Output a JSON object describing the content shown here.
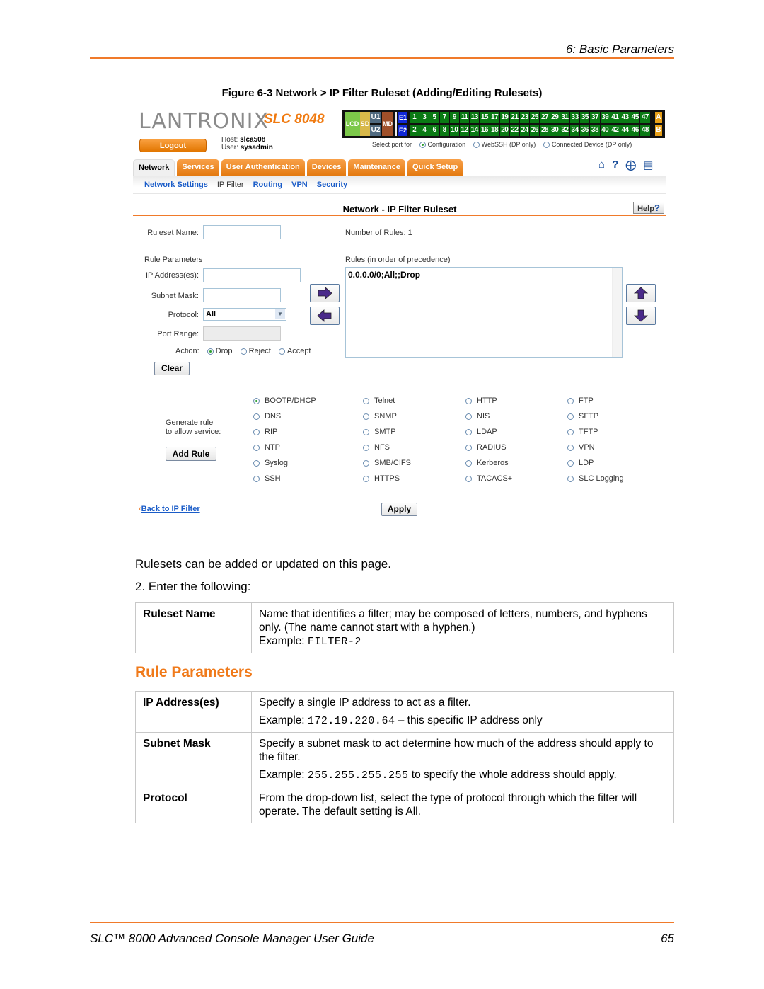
{
  "page": {
    "chapter": "6: Basic Parameters",
    "figure_caption": "Figure 6-3  Network > IP Filter Ruleset (Adding/Editing Rulesets)",
    "footer_title": "SLC™ 8000 Advanced Console Manager User Guide",
    "page_number": "65"
  },
  "colors": {
    "accent": "#f07a2a",
    "link": "#1a5cc8",
    "port_green": "#0a7a14"
  },
  "app": {
    "logo": "LANTRONIX",
    "model": "SLC 8048",
    "logout_label": "Logout",
    "host_label": "Host:",
    "host_value": "slca508",
    "user_label": "User:",
    "user_value": "sysadmin",
    "status_blocks": {
      "lcd": "LCD",
      "sd": "SD",
      "u1": "U1",
      "u2": "U2",
      "md": "MD",
      "e1": "E1",
      "e2": "E2",
      "a": "A",
      "b": "B"
    },
    "ports_odd": [
      "1",
      "3",
      "5",
      "7",
      "9",
      "11",
      "13",
      "15",
      "17",
      "19",
      "21",
      "23",
      "25",
      "27",
      "29",
      "31",
      "33",
      "35",
      "37",
      "39",
      "41",
      "43",
      "45",
      "47"
    ],
    "ports_even": [
      "2",
      "4",
      "6",
      "8",
      "10",
      "12",
      "14",
      "16",
      "18",
      "20",
      "22",
      "24",
      "26",
      "28",
      "30",
      "32",
      "34",
      "36",
      "38",
      "40",
      "42",
      "44",
      "46",
      "48"
    ],
    "select_port": {
      "label": "Select port for",
      "options": [
        {
          "label": "Configuration",
          "selected": true
        },
        {
          "label": "WebSSH (DP only)",
          "selected": false
        },
        {
          "label": "Connected Device (DP only)",
          "selected": false
        }
      ]
    },
    "tabs": [
      {
        "label": "Network",
        "active": true
      },
      {
        "label": "Services",
        "active": false
      },
      {
        "label": "User Authentication",
        "active": false
      },
      {
        "label": "Devices",
        "active": false
      },
      {
        "label": "Maintenance",
        "active": false
      },
      {
        "label": "Quick Setup",
        "active": false
      }
    ],
    "toolbar_icons": [
      "home-icon",
      "help-icon",
      "sitemap-icon",
      "log-icon"
    ],
    "subnav": [
      {
        "label": "Network Settings",
        "current": false
      },
      {
        "label": "IP Filter",
        "current": true
      },
      {
        "label": "Routing",
        "current": false
      },
      {
        "label": "VPN",
        "current": false
      },
      {
        "label": "Security",
        "current": false
      }
    ],
    "page_title": "Network - IP Filter Ruleset",
    "help_label": "Help",
    "form": {
      "ruleset_name_label": "Ruleset Name:",
      "ruleset_name_value": "",
      "number_of_rules_label": "Number of Rules:",
      "number_of_rules_value": "1",
      "rule_parameters_heading": "Rule Parameters",
      "ip_label": "IP Address(es):",
      "ip_value": "",
      "subnet_label": "Subnet Mask:",
      "subnet_value": "",
      "protocol_label": "Protocol:",
      "protocol_value": "All",
      "port_range_label": "Port Range:",
      "port_range_value": "",
      "action_label": "Action:",
      "actions": [
        {
          "label": "Drop",
          "selected": true
        },
        {
          "label": "Reject",
          "selected": false
        },
        {
          "label": "Accept",
          "selected": false
        }
      ],
      "clear_label": "Clear",
      "rules_heading": "Rules",
      "rules_heading_suffix": " (in order of precedence)",
      "rules": [
        "0.0.0.0/0;All;;Drop"
      ],
      "generate_label_1": "Generate rule",
      "generate_label_2": "to allow service:",
      "add_rule_label": "Add Rule",
      "services": [
        [
          "BOOTP/DHCP",
          "DNS",
          "RIP",
          "NTP",
          "Syslog",
          "SSH"
        ],
        [
          "Telnet",
          "SNMP",
          "SMTP",
          "NFS",
          "SMB/CIFS",
          "HTTPS"
        ],
        [
          "HTTP",
          "NIS",
          "LDAP",
          "RADIUS",
          "Kerberos",
          "TACACS+"
        ],
        [
          "FTP",
          "SFTP",
          "TFTP",
          "VPN",
          "LDP",
          "SLC Logging"
        ]
      ],
      "selected_service": "BOOTP/DHCP",
      "back_link": "Back to IP Filter",
      "apply_label": "Apply"
    }
  },
  "body": {
    "intro": "Rulesets can be added or updated on this page.",
    "step": "2.   Enter the following:",
    "table1": [
      {
        "key": "Ruleset Name",
        "desc": "Name that identifies a filter; may be composed of letters, numbers, and hyphens only. (The name cannot start with a hyphen.)",
        "example_label": "Example:  ",
        "example": "FILTER-2"
      }
    ],
    "section_title": "Rule Parameters",
    "table2": [
      {
        "key": "IP Address(es)",
        "desc": "Specify a single IP address to act as a filter.",
        "example_label": "Example: ",
        "example": "172.19.220.64",
        "example_suffix": " – this specific IP address only"
      },
      {
        "key": "Subnet Mask",
        "desc": "Specify a subnet mask to act determine how much of the address should apply to the filter.",
        "example_label": "Example: ",
        "example": "255.255.255.255",
        "example_suffix": "  to specify the whole address should apply."
      },
      {
        "key": "Protocol",
        "desc": "From the drop-down list, select the type of protocol through which the filter will operate. The default setting is All."
      }
    ]
  }
}
